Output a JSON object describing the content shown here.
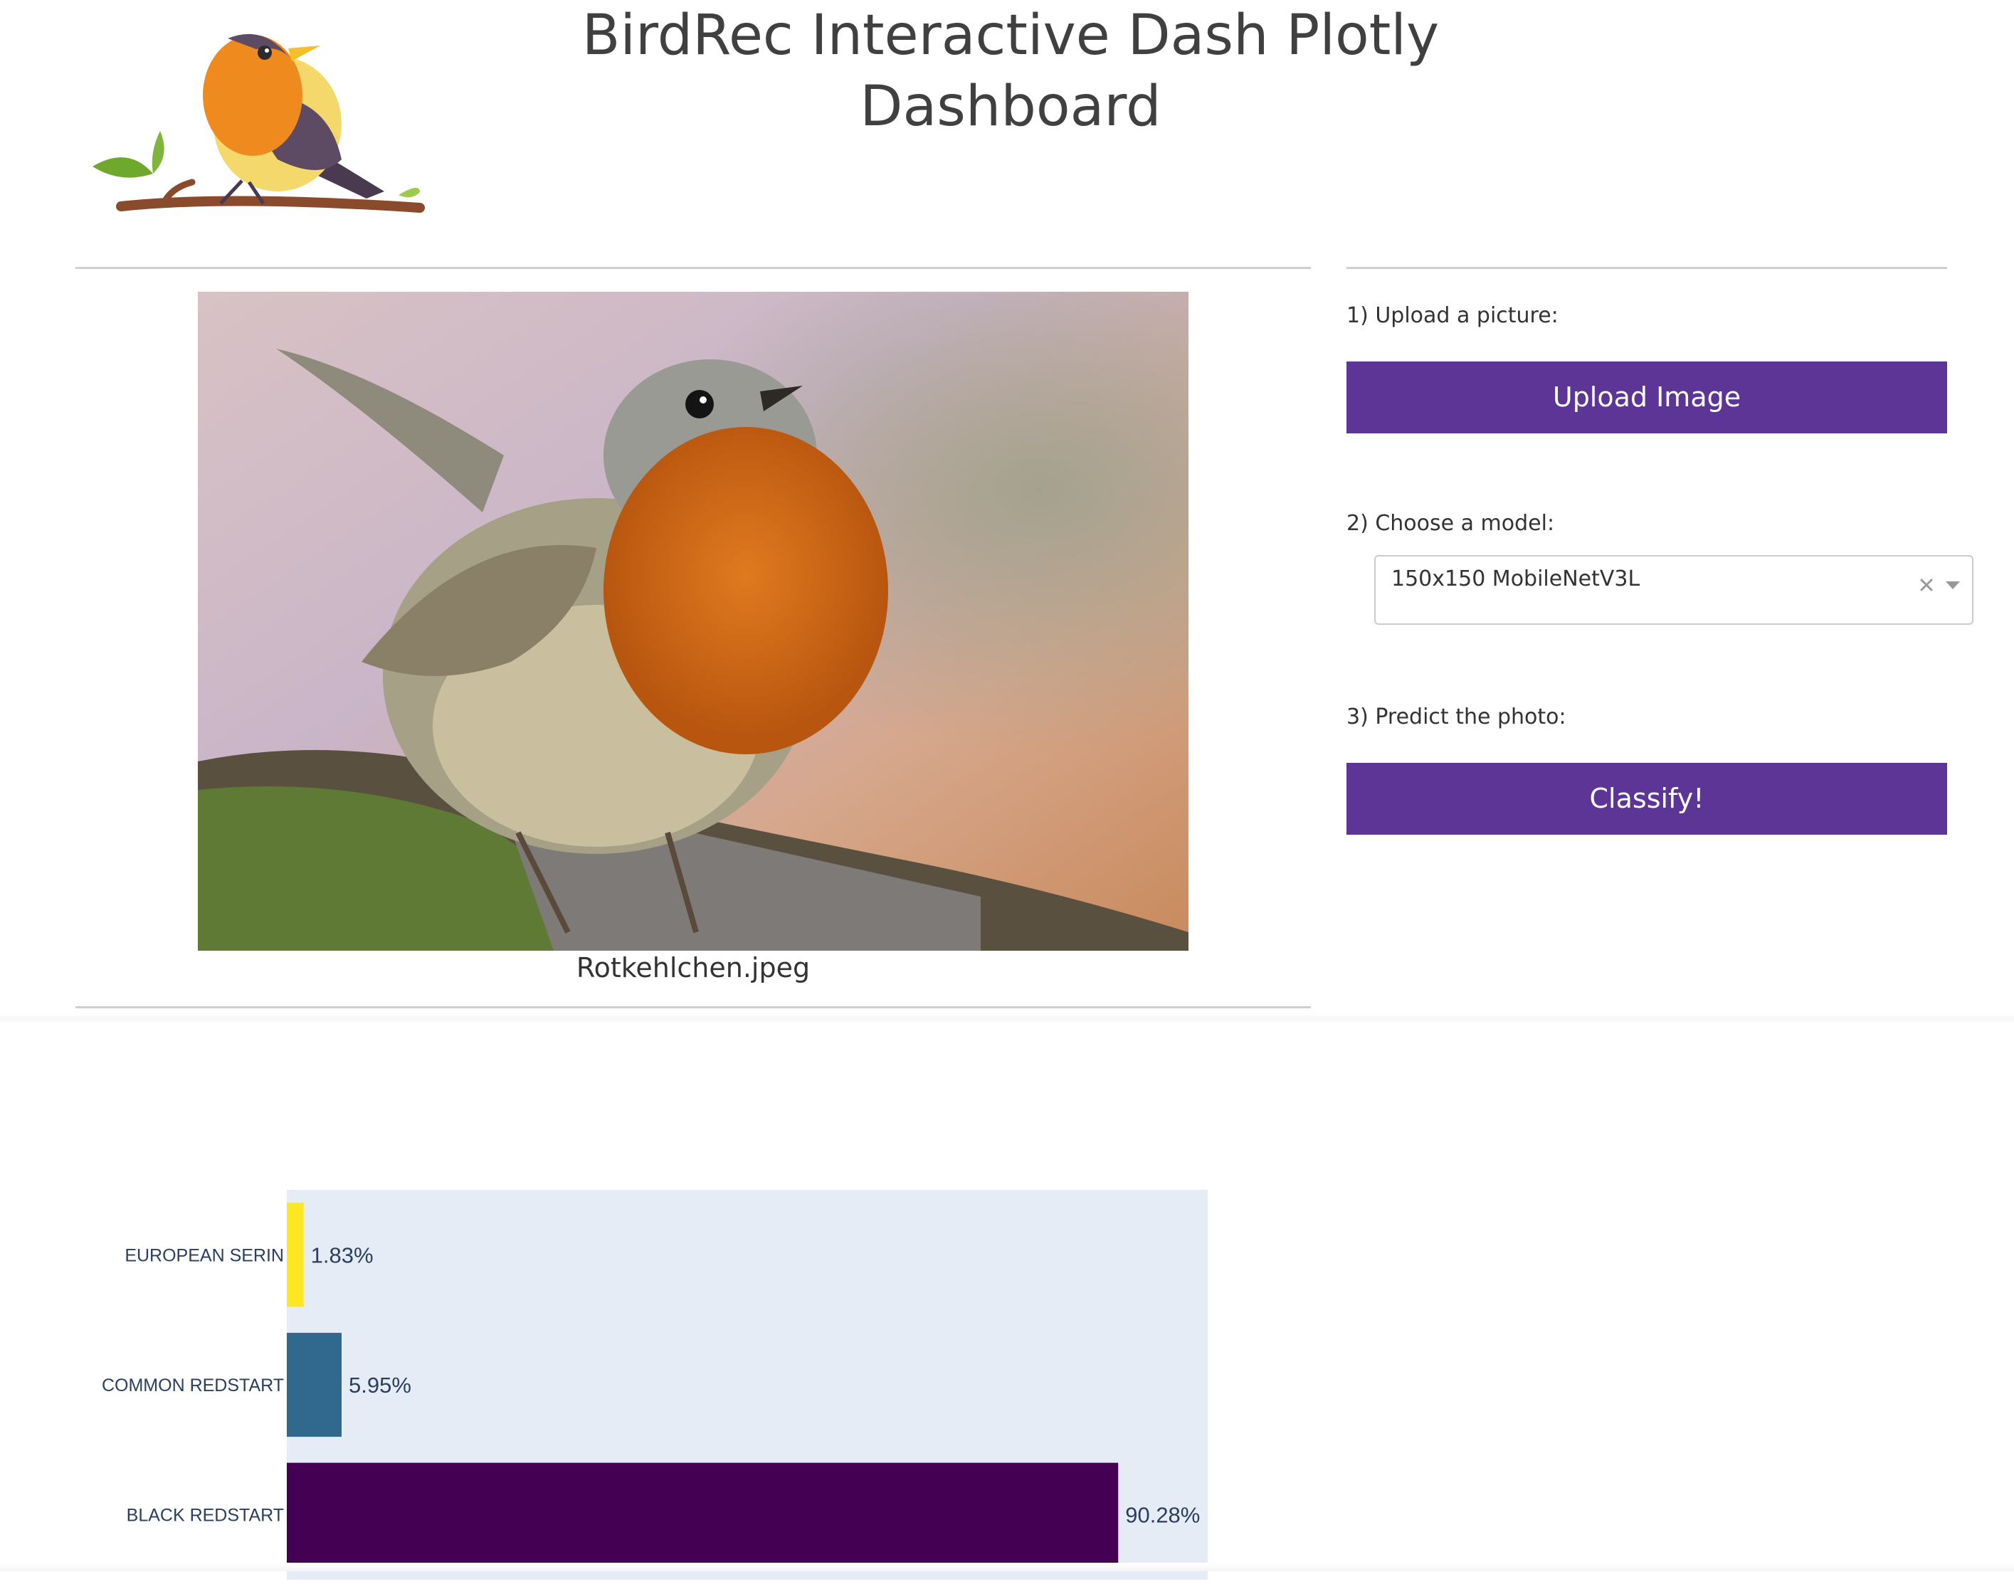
{
  "header": {
    "title": "BirdRec Interactive Dash Plotly Dashboard",
    "logo_icon": "robin-on-branch-logo"
  },
  "image_panel": {
    "filename": "Rotkehlchen.jpeg",
    "photo_icon": "robin-photo"
  },
  "controls": {
    "step1_label": "1) Upload a picture:",
    "upload_button": "Upload Image",
    "step2_label": "2) Choose a model:",
    "model_selected": "150x150 MobileNetV3L",
    "step3_label": "3) Predict the photo:",
    "classify_button": "Classify!",
    "accent_color": "#5c3596"
  },
  "chart_data": {
    "type": "bar",
    "orientation": "horizontal",
    "categories": [
      "EUROPEAN SERIN",
      "COMMON REDSTART",
      "BLACK REDSTART"
    ],
    "values": [
      1.83,
      5.95,
      90.28
    ],
    "labels": [
      "1.83%",
      "5.95%",
      "90.28%"
    ],
    "colors": [
      "#fde725",
      "#31688e",
      "#440154"
    ],
    "plot_background": "#e5ecf6",
    "xlim": [
      0,
      100
    ],
    "grid": false,
    "legend": false
  }
}
